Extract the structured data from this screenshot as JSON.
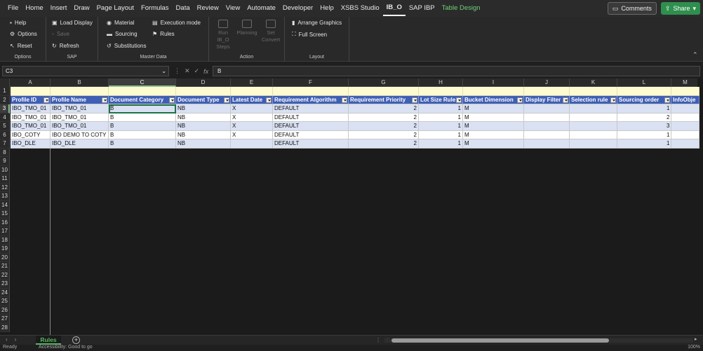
{
  "menubar": {
    "tabs": [
      "File",
      "Home",
      "Insert",
      "Draw",
      "Page Layout",
      "Formulas",
      "Data",
      "Review",
      "View",
      "Automate",
      "Developer",
      "Help",
      "XSBS Studio",
      "IB_O",
      "SAP IBP",
      "Table Design"
    ],
    "active_tab": "IB_O",
    "comments_label": "Comments",
    "share_label": "Share"
  },
  "ribbon": {
    "options": {
      "help": "Help",
      "options": "Options",
      "reset": "Reset",
      "label": "Options"
    },
    "sap": {
      "load_display": "Load Display",
      "save": "Save",
      "refresh": "Refresh",
      "label": "SAP"
    },
    "master_data": {
      "material": "Material",
      "sourcing": "Sourcing",
      "substitutions": "Substitutions",
      "execution_mode": "Execution mode",
      "rules": "Rules",
      "label": "Master Data"
    },
    "action": {
      "run": "Run IB_O Steps",
      "planning": "Planning",
      "set_convert": "Set Convert",
      "label": "Action"
    },
    "layout": {
      "arrange": "Arrange Graphics",
      "fullscreen": "Full Screen",
      "label": "Layout"
    }
  },
  "formula_bar": {
    "name_box": "C3",
    "formula": "B"
  },
  "grid": {
    "columns": [
      "A",
      "B",
      "C",
      "D",
      "E",
      "F",
      "G",
      "H",
      "I",
      "J",
      "K",
      "L",
      "M"
    ],
    "selected_column": "C",
    "rows": [
      "1",
      "2",
      "3",
      "4",
      "5",
      "6",
      "7",
      "8",
      "9",
      "10",
      "11",
      "12",
      "13",
      "14",
      "15",
      "16",
      "17",
      "18",
      "19",
      "20",
      "21",
      "22",
      "23",
      "24",
      "25",
      "26",
      "27",
      "28"
    ],
    "selected_row": "3",
    "headers": [
      "Profile ID",
      "Profile Name",
      "Document Category",
      "Document Type",
      "Latest Date",
      "Requirement Algorithm",
      "Requirement Priority",
      "Lot Size Rule",
      "Bucket Dimension",
      "Display Filter",
      "Selection rule",
      "Sourcing order",
      "InfoObje"
    ],
    "data": [
      [
        "IBO_TMO_01",
        "IBO_TMO_01",
        "B",
        "NB",
        "X",
        "DEFAULT",
        "2",
        "1",
        "M",
        "",
        "",
        "1",
        ""
      ],
      [
        "IBO_TMO_01",
        "IBO_TMO_01",
        "B",
        "NB",
        "X",
        "DEFAULT",
        "2",
        "1",
        "M",
        "",
        "",
        "2",
        ""
      ],
      [
        "IBO_TMO_01",
        "IBO_TMO_01",
        "B",
        "NB",
        "X",
        "DEFAULT",
        "2",
        "1",
        "M",
        "",
        "",
        "3",
        ""
      ],
      [
        "IBO_COTY",
        "IBO DEMO TO COTY",
        "B",
        "NB",
        "X",
        "DEFAULT",
        "2",
        "1",
        "M",
        "",
        "",
        "1",
        ""
      ],
      [
        "IBO_DLE",
        "IBO_DLE",
        "B",
        "NB",
        "",
        "DEFAULT",
        "2",
        "1",
        "M",
        "",
        "",
        "1",
        ""
      ]
    ]
  },
  "sheets": {
    "active": "Rules"
  },
  "status": {
    "ready": "Ready",
    "accessibility": "Accessibility: Good to go",
    "zoom": "100%"
  },
  "colors": {
    "header_blue": "#3f5fb4",
    "band_blue": "#d9e1f3",
    "active_green": "#1e7145",
    "sheet_tab_green": "#57b866"
  }
}
